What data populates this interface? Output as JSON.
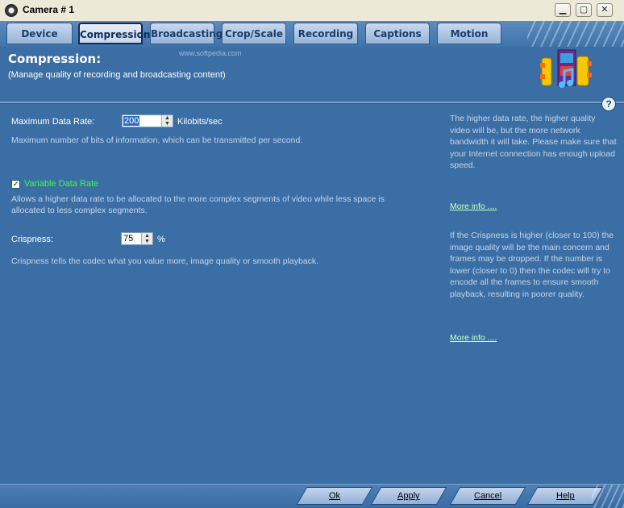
{
  "window": {
    "title": "Camera # 1"
  },
  "title_buttons": {
    "minimize": "▁",
    "maximize": "▢",
    "close": "✕"
  },
  "tabs": [
    {
      "label": "Device"
    },
    {
      "label": "Compression",
      "active": true
    },
    {
      "label": "Broadcasting"
    },
    {
      "label": "Crop/Scale"
    },
    {
      "label": "Recording"
    },
    {
      "label": "Captions"
    },
    {
      "label": "Motion"
    }
  ],
  "watermark": "www.softpedia.com",
  "header": {
    "title": "Compression:",
    "subtitle": "(Manage quality of recording and broadcasting content)",
    "help_glyph": "?"
  },
  "max_rate": {
    "label": "Maximum Data Rate:",
    "value": "200",
    "unit": "Kilobits/sec",
    "description": "Maximum number of bits of information, which can be transmitted per second."
  },
  "variable_rate": {
    "label": "Variable Data Rate",
    "checked": true,
    "check_glyph": "✓",
    "description": "Allows a higher data rate to be allocated to the more complex segments of video while less space is allocated to less complex segments."
  },
  "crispness": {
    "label": "Crispness:",
    "value": "75",
    "unit": "%",
    "description": "Crispness tells the codec what you value more, image quality or smooth playback."
  },
  "side_notes": {
    "rate_help": "The higher data rate, the higher quality video will be, but the more network bandwidth it will take. Please make sure that your Internet connection has enough upload speed.",
    "more_info_1": "More info ....",
    "crispness_help": "If the Crispness is higher (closer to 100) the image quality will be the main concern and frames may be dropped. If the number is lower (closer to 0) then the codec will try to encode all the frames to ensure smooth playback, resulting in poorer quality.",
    "more_info_2": "More info ...."
  },
  "footer": {
    "ok": "Ok",
    "apply": "Apply",
    "cancel": "Cancel",
    "help": "Help"
  },
  "colors": {
    "panel": "#3a6ea5",
    "tab_active_border": "#0d2d5a",
    "checkbox_label": "#40ff40"
  }
}
